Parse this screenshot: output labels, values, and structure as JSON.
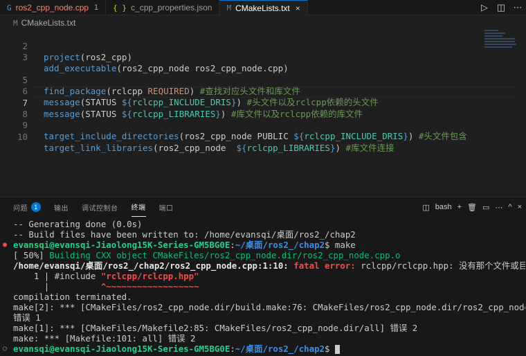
{
  "tabs": [
    {
      "icon": "G",
      "label": "ros2_cpp_node.cpp",
      "badge": "1"
    },
    {
      "icon": "{ }",
      "label": "c_cpp_properties.json"
    },
    {
      "icon": "M",
      "label": "CMakeLists.txt",
      "close": "×"
    }
  ],
  "tab_actions": {
    "run": "▷",
    "split": "◫",
    "more": "⋯"
  },
  "breadcrumb": {
    "icon": "M",
    "label": "CMakeLists.txt"
  },
  "editor": {
    "line_numbers": [
      "2",
      "3",
      "5",
      "6",
      "7",
      "8",
      "9",
      "10"
    ],
    "lines": [
      {
        "fn": "project",
        "p1": "(",
        "a": "ros2_cpp",
        "p2": ")"
      },
      {
        "fn": "add_executable",
        "p1": "(",
        "a": "ros2_cpp_node ros2_cpp_node.cpp",
        "p2": ")"
      },
      {
        "fn": "find_package",
        "p1": "(",
        "a": "rclcpp ",
        "kw": "REQUIRED",
        "p2": ")",
        "cm": " #查找对应头文件和库文件"
      },
      {
        "fn": "message",
        "p1": "(",
        "a": "STATUS ",
        "v1": "${",
        "vi": "rclcpp_INCLUDE_DRIS",
        "v2": "}",
        "p2": ")",
        "cm": " #头文件以及rclcpp依赖的头文件"
      },
      {
        "fn": "message",
        "p1": "(",
        "a": "STATUS ",
        "v1": "${",
        "vi": "rclcpp_LIBRARIES",
        "v2": "}",
        "p2": ")",
        "cm": " #库文件以及rclcpp依赖的库文件"
      },
      {
        "fn": "target_include_directories",
        "p1": "(",
        "a": "ros2_cpp_node PUBLIC ",
        "v1": "${",
        "vi": "rclcpp_INCLUDE_DRIS",
        "v2": "}",
        "p2": ")",
        "cm": " #头文件包含"
      },
      {
        "fn": "target_link_libraries",
        "p1": "(",
        "a": "ros2_cpp_node  ",
        "v1": "${",
        "vi": "rclcpp_LIBRARIES",
        "v2": "}",
        "p2": ")",
        "cm": " #库文件连接"
      }
    ]
  },
  "panel": {
    "tabs": [
      "问题",
      "输出",
      "调试控制台",
      "终端",
      "端口"
    ],
    "problems_count": "1",
    "shell": "bash",
    "actions": {
      "split": "◫",
      "new": "+",
      "trash": "🗑",
      "layout": "▭",
      "more": "⋯",
      "max": "^",
      "close": "×"
    }
  },
  "terminal": {
    "l1": "-- Generating done (0.0s)",
    "l2": "-- Build files have been written to: /home/evansqi/桌面/ros2_/chap2",
    "prompt_user": "evansqi@evansqi-Jiaolong15K-Series-GM5BG0E",
    "prompt_sep": ":",
    "prompt_path": "~/桌面/ros2_/chap2",
    "prompt_end": "$ ",
    "cmd": "make",
    "l4a": "[ 50%] ",
    "l4b": "Building CXX object CMakeFiles/ros2_cpp_node.dir/ros2_cpp_node.cpp.o",
    "l5a": "/home/evansqi/桌面/ros2_/chap2/ros2_cpp_node.cpp:1:10: ",
    "l5b": "fatal error: ",
    "l5c": "rclcpp/rclcpp.hpp: 没有那个文件或目录",
    "l6a": "    1 | #include ",
    "l6b": "\"rclcpp/rclcpp.hpp\"",
    "l7a": "      |          ",
    "l7b": "^~~~~~~~~~~~~~~~~~~",
    "l8": "compilation terminated.",
    "l9": "make[2]: *** [CMakeFiles/ros2_cpp_node.dir/build.make:76: CMakeFiles/ros2_cpp_node.dir/ros2_cpp_node.cpp.o]",
    "l10": "错误 1",
    "l11": "make[1]: *** [CMakeFiles/Makefile2:85: CMakeFiles/ros2_cpp_node.dir/all] 错误 2",
    "l12": "make: *** [Makefile:101: all] 错误 2"
  }
}
